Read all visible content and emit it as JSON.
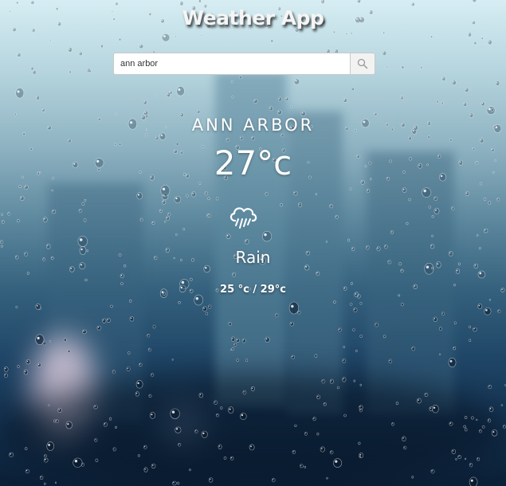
{
  "app": {
    "title": "Weather App"
  },
  "search": {
    "value": "ann arbor",
    "icon": "search-icon"
  },
  "weather": {
    "city": "ANN ARBOR",
    "temperature": "27°c",
    "icon": "rain-cloud-icon",
    "description": "Rain",
    "range": "25 °c / 29°c"
  },
  "theme": {
    "text_color": "#ffffff",
    "sky_color": "#d6edf3",
    "deep_color": "#0b1f36"
  }
}
